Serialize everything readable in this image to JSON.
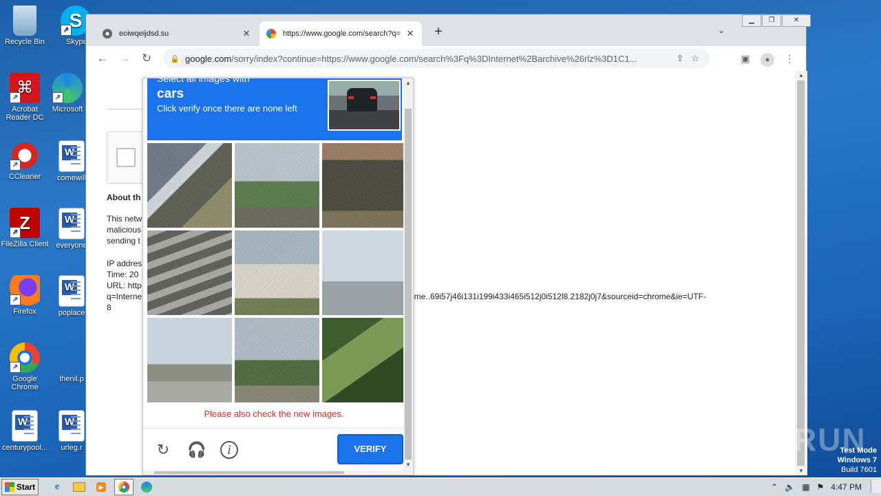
{
  "desktop": {
    "icons": [
      {
        "label": "Recycle Bin"
      },
      {
        "label": "Skype"
      },
      {
        "label": "Acrobat Reader DC"
      },
      {
        "label": "Microsoft"
      },
      {
        "label": "CCleaner"
      },
      {
        "label": "comewill"
      },
      {
        "label": "FileZilla Client"
      },
      {
        "label": "everyone"
      },
      {
        "label": "Firefox"
      },
      {
        "label": "poplace"
      },
      {
        "label": "Google Chrome"
      },
      {
        "label": "thenil.p"
      },
      {
        "label": "centurypool..."
      },
      {
        "label": "urleg.r"
      }
    ]
  },
  "browser": {
    "tabs": [
      {
        "title": "eoiwqeijdsd.su",
        "close": "✕"
      },
      {
        "title": "https://www.google.com/search?q=",
        "close": "✕"
      }
    ],
    "new_tab": "+",
    "url_host": "google.com",
    "url_rest": "/sorry/index?continue=https://www.google.com/search%3Fq%3DInternet%2Barchive%26rlz%3D1C1..."
  },
  "page": {
    "about_heading": "About th",
    "para": [
      "This netw",
      "malicious",
      "sending t"
    ],
    "ip_line": "IP addres",
    "time_line": "Time: 20",
    "url_line": "URL: http",
    "url_cont": "q=Interne",
    "url_tail": "ome..69i57j46i131i199i433i465i512j0i512l8.2182j0j7&sourceid=chrome&ie=UTF-",
    "url_end": "8"
  },
  "challenge": {
    "instruction_top": "Select all images with",
    "target": "cars",
    "subtext": "Click verify once there are none left",
    "warning": "Please also check the new images.",
    "verify_label": "VERIFY"
  },
  "watermark": {
    "brand": "ANY RUN",
    "test_mode": "Test Mode",
    "os": "Windows 7",
    "build": "Build 7601"
  },
  "taskbar": {
    "start_label": "Start",
    "clock": "4:47 PM"
  }
}
